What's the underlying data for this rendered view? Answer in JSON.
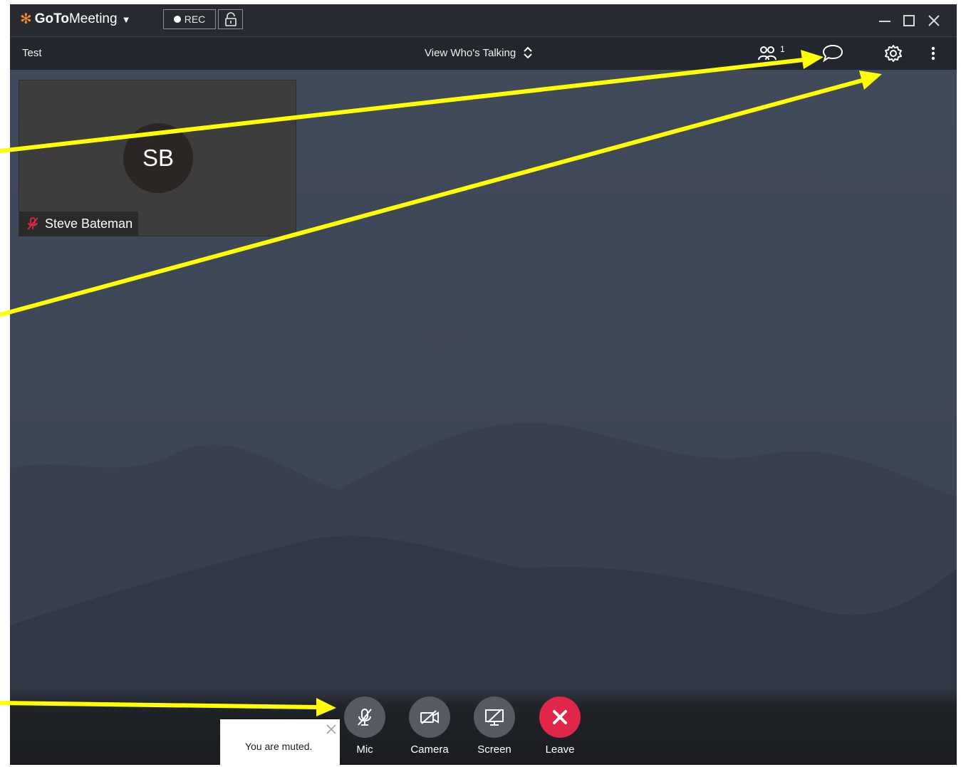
{
  "app": {
    "logo_bold": "GoTo",
    "logo_light": "Meeting",
    "rec_label": "REC"
  },
  "toolbar": {
    "meeting_name": "Test",
    "view_label": "View Who's Talking",
    "attendee_count": "1"
  },
  "participant": {
    "initials": "SB",
    "name": "Steve Bateman",
    "muted": true
  },
  "controls": {
    "mic_label": "Mic",
    "camera_label": "Camera",
    "screen_label": "Screen",
    "leave_label": "Leave"
  },
  "toast": {
    "message": "You are muted."
  },
  "colors": {
    "brand_orange": "#f68d2e",
    "leave_red": "#e0274a",
    "annotation_yellow": "#ffff00"
  }
}
